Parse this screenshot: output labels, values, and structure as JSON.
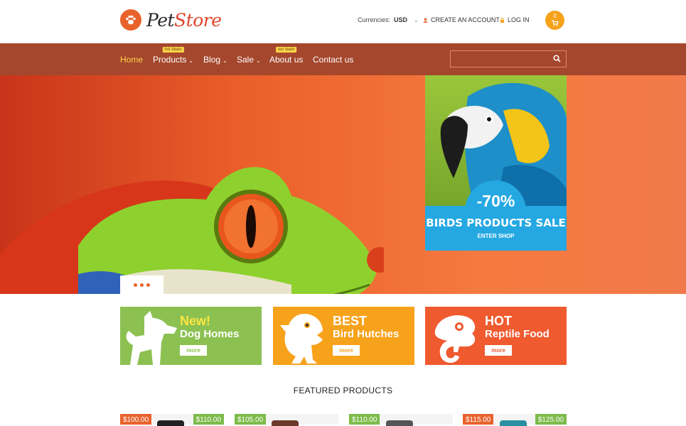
{
  "header": {
    "logo_part1": "Pet",
    "logo_part2": "Store",
    "currencies_label": "Currencies:",
    "currency_value": "USD",
    "create_account": "CREATE AN ACCOUNT",
    "login": "LOG IN",
    "cart_count": "0"
  },
  "nav": {
    "items": [
      {
        "label": "Home",
        "badge": ""
      },
      {
        "label": "Products",
        "badge": "hot deals"
      },
      {
        "label": "Blog",
        "badge": ""
      },
      {
        "label": "Sale",
        "badge": ""
      },
      {
        "label": "About us",
        "badge": "our team"
      },
      {
        "label": "Contact us",
        "badge": ""
      }
    ],
    "search_placeholder": ""
  },
  "promo": {
    "discount": "-70%",
    "title": "BIRDS PRODUCTS SALE",
    "link": "ENTER SHOP"
  },
  "banners": [
    {
      "line1": "New!",
      "line2": "Dog Homes",
      "more": "more",
      "color": "#8cc152",
      "accent": "#ffe640"
    },
    {
      "line1": "BEST",
      "line2": "Bird Hutches",
      "more": "more",
      "color": "#f7a21b",
      "accent": "#ffffff"
    },
    {
      "line1": "HOT",
      "line2": "Reptile Food",
      "more": "more",
      "color": "#ef5a2f",
      "accent": "#ffffff"
    }
  ],
  "featured_title": "FEATURED PRODUCTS",
  "products": [
    {
      "price_old": "$100.00",
      "price_new": "$110.00"
    },
    {
      "price_old": "$105.00",
      "price_new": ""
    },
    {
      "price_old": "$110.00",
      "price_new": ""
    },
    {
      "price_old": "$115.00",
      "price_new": "$125.00"
    }
  ],
  "colors": {
    "brand_orange": "#e8622c",
    "nav_brown": "#a5472d",
    "active_yellow": "#ffd54a",
    "promo_blue": "#25a8e2"
  }
}
